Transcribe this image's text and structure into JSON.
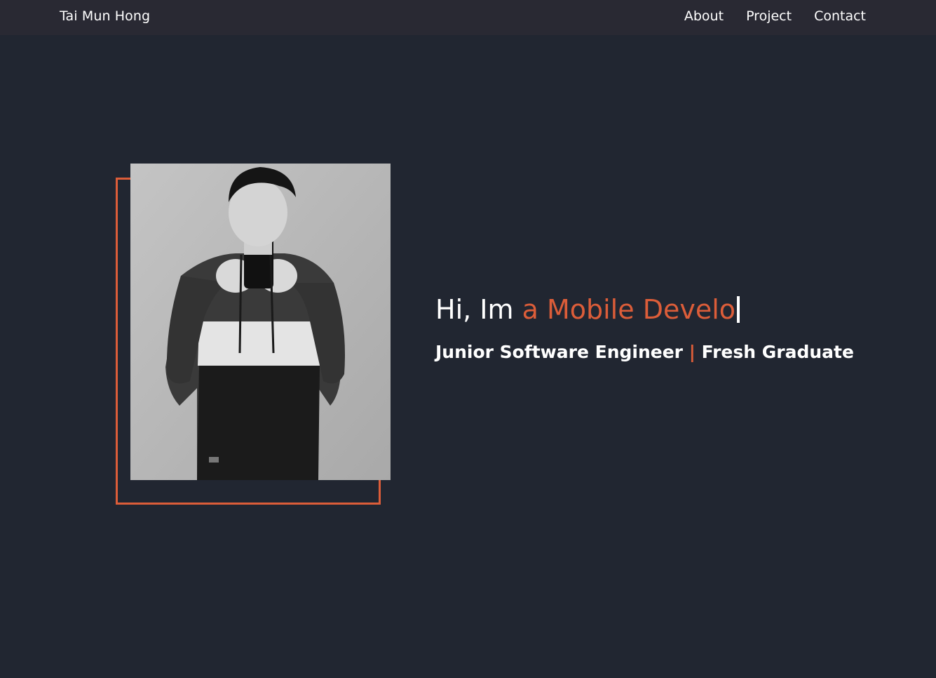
{
  "nav": {
    "brand": "Tai Mun Hong",
    "links": [
      "About",
      "Project",
      "Contact"
    ]
  },
  "hero": {
    "greeting": "Hi, Im ",
    "typed_text": "a Mobile Develo",
    "subtitle_left": "Junior Software Engineer",
    "subtitle_separator": "|",
    "subtitle_right": "Fresh Graduate",
    "photo_alt": "Portrait photo of Tai Mun Hong"
  },
  "colors": {
    "background": "#212631",
    "navbar": "#292933",
    "accent": "#dc5d39",
    "text": "#ffffff"
  }
}
